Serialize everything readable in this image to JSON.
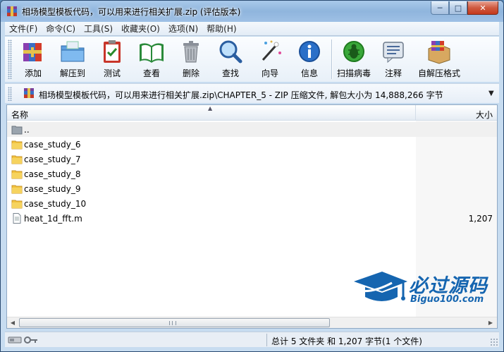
{
  "window": {
    "title": "相场模型模板代码，可以用来进行相关扩展.zip (评估版本)",
    "minimize": "─",
    "maximize": "□",
    "close": "✕"
  },
  "menu": [
    "文件(F)",
    "命令(C)",
    "工具(S)",
    "收藏夹(O)",
    "选项(N)",
    "帮助(H)"
  ],
  "toolbar": {
    "add": "添加",
    "extract_to": "解压到",
    "test": "测试",
    "view": "查看",
    "delete": "删除",
    "find": "查找",
    "wizard": "向导",
    "info": "信息",
    "virus_scan": "扫描病毒",
    "comment": "注释",
    "sfx": "自解压格式"
  },
  "address": {
    "path": "相场模型模板代码，可以用来进行相关扩展.zip\\CHAPTER_5 - ZIP 压缩文件, 解包大小为 14,888,266 字节"
  },
  "filelist": {
    "col_name": "名称",
    "col_size": "大小",
    "rows": [
      {
        "name": "..",
        "size": ""
      },
      {
        "name": "case_study_6",
        "size": ""
      },
      {
        "name": "case_study_7",
        "size": ""
      },
      {
        "name": "case_study_8",
        "size": ""
      },
      {
        "name": "case_study_9",
        "size": ""
      },
      {
        "name": "case_study_10",
        "size": ""
      },
      {
        "name": "heat_1d_fft.m",
        "size": "1,207"
      }
    ]
  },
  "watermark": {
    "big": "必过源码",
    "small": "Biguo100.com"
  },
  "status": {
    "summary": "总计 5 文件夹 和 1,207 字节(1 个文件)"
  },
  "colors": {
    "accent": "#1565b0",
    "folder": "#e8b830"
  }
}
